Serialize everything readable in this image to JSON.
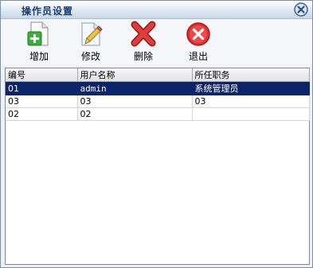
{
  "window": {
    "title": "操作员设置",
    "close_icon": "close-circle-icon"
  },
  "toolbar": {
    "buttons": [
      {
        "label": "增加",
        "icon": "add-document-icon"
      },
      {
        "label": "修改",
        "icon": "edit-document-icon"
      },
      {
        "label": "删除",
        "icon": "red-x-delete-icon"
      },
      {
        "label": "退出",
        "icon": "exit-circle-icon"
      }
    ]
  },
  "grid": {
    "columns": [
      "编号",
      "用户名称",
      "所任职务"
    ],
    "rows": [
      {
        "cells": [
          "01",
          "admin",
          "系统管理员"
        ],
        "selected": true
      },
      {
        "cells": [
          "03",
          "03",
          "03"
        ],
        "selected": false
      },
      {
        "cells": [
          "02",
          "02",
          ""
        ],
        "selected": false
      }
    ]
  },
  "colors": {
    "selection": "#0a246a",
    "title_text": "#1b3f78"
  }
}
